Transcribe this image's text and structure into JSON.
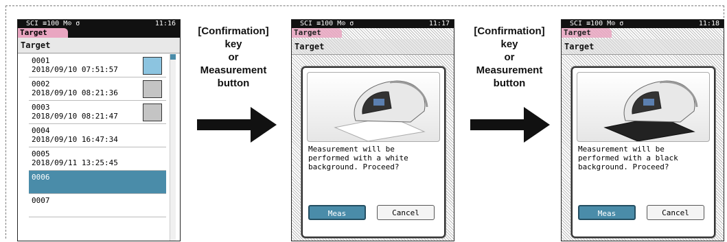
{
  "screens": {
    "status_text": "SCI ≡100 M⊙ σ",
    "list_screen": {
      "time": "11:16",
      "tab_label": "Target",
      "header": "Target",
      "items": [
        {
          "id": "0001",
          "date": "2018/09/10 07:51:57",
          "swatch": "#8cc4e0"
        },
        {
          "id": "0002",
          "date": "2018/09/10 08:21:36",
          "swatch": "#c4c4c4"
        },
        {
          "id": "0003",
          "date": "2018/09/10 08:21:47",
          "swatch": "#c4c4c4"
        },
        {
          "id": "0004",
          "date": "2018/09/10 16:47:34",
          "swatch": ""
        },
        {
          "id": "0005",
          "date": "2018/09/11 13:25:45",
          "swatch": ""
        },
        {
          "id": "0006",
          "date": "",
          "swatch": "",
          "selected": true
        },
        {
          "id": "0007",
          "date": "",
          "swatch": ""
        }
      ]
    },
    "white_dialog": {
      "time": "11:17",
      "tab_label": "Target",
      "header": "Target",
      "message": "Measurement will be performed with a white background. Proceed?",
      "meas_label": "Meas",
      "cancel_label": "Cancel"
    },
    "black_dialog": {
      "time": "11:18",
      "tab_label": "Target",
      "header": "Target",
      "message": "Measurement will be performed with a black background. Proceed?",
      "meas_label": "Meas",
      "cancel_label": "Cancel"
    }
  },
  "captions": {
    "first": [
      "[Confirmation]",
      "key",
      "or",
      "Measurement",
      "button"
    ],
    "second": [
      "[Confirmation]",
      "key",
      "or",
      "Measurement",
      "button"
    ]
  },
  "colors": {
    "accent": "#4a8ca9",
    "tab": "#e9a6c1",
    "arrow": "#111111"
  }
}
